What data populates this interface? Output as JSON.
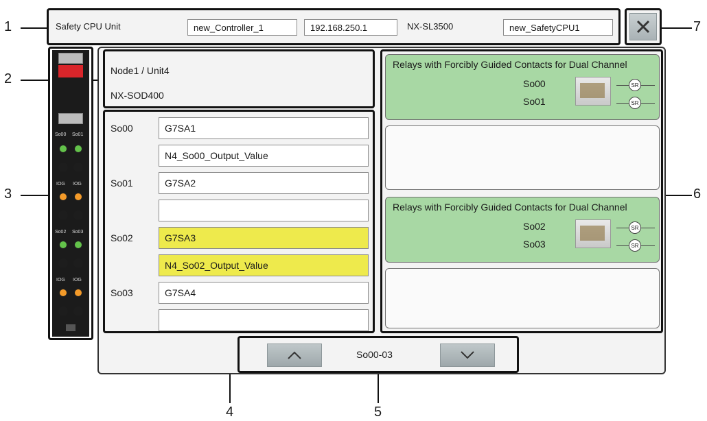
{
  "header": {
    "unit_type": "Safety CPU Unit",
    "controller_name": "new_Controller_1",
    "ip_address": "192.168.250.1",
    "model": "NX-SL3500",
    "safety_cpu_name": "new_SafetyCPU1"
  },
  "callouts": [
    "1",
    "2",
    "3",
    "4",
    "5",
    "6",
    "7"
  ],
  "unit_info": {
    "location": "Node1 / Unit4",
    "model": "NX-SOD400"
  },
  "sidebar_unit": {
    "terminal_labels": [
      "So00",
      "So01",
      "IOG",
      "IOG",
      "So02",
      "So03",
      "IOG",
      "IOG"
    ]
  },
  "outputs": [
    {
      "label": "So00",
      "device": "G7SA1",
      "variable": "N4_So00_Output_Value",
      "highlighted": false
    },
    {
      "label": "So01",
      "device": "G7SA2",
      "variable": "",
      "highlighted": false
    },
    {
      "label": "So02",
      "device": "G7SA3",
      "variable": "N4_So02_Output_Value",
      "highlighted": true
    },
    {
      "label": "So03",
      "device": "G7SA4",
      "variable": "",
      "highlighted": false
    }
  ],
  "device_cards": [
    {
      "title": "Relays with Forcibly Guided Contacts for Dual Channel",
      "channels": [
        "So00",
        "So01"
      ],
      "filled": true
    },
    {
      "title": "",
      "channels": [],
      "filled": false
    },
    {
      "title": "Relays with Forcibly Guided Contacts for Dual Channel",
      "channels": [
        "So02",
        "So03"
      ],
      "filled": true
    },
    {
      "title": "",
      "channels": [],
      "filled": false
    }
  ],
  "sr_symbol": "SR",
  "pager": {
    "range_label": "So00-03"
  },
  "colors": {
    "highlight": "#eeea4c",
    "card_green": "#a8d8a4",
    "led_green": "#63c24a",
    "led_orange": "#f39a29",
    "unit_red": "#d9252a"
  },
  "icons": {
    "close": "close-icon",
    "up": "chevron-up-icon",
    "down": "chevron-down-icon"
  }
}
